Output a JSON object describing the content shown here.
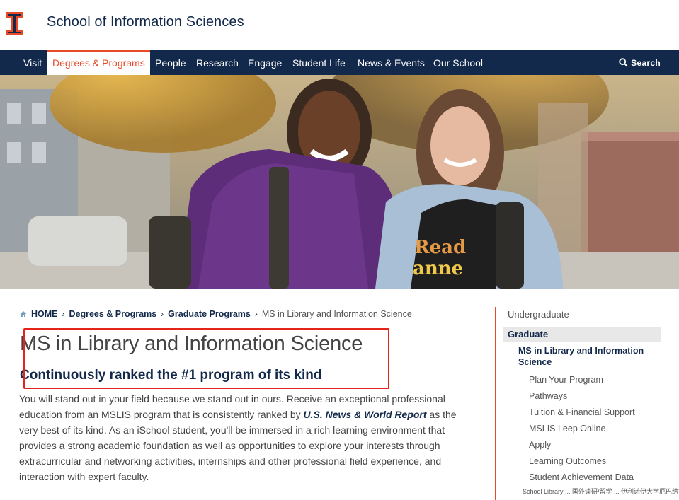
{
  "header": {
    "site_title": "School of Information Sciences",
    "brand_orange": "#e84a27",
    "brand_navy": "#13294b",
    "logo_icon": "block-i-logo"
  },
  "nav": {
    "items": [
      {
        "label": "Visit"
      },
      {
        "label": "Degrees & Programs",
        "active": true
      },
      {
        "label": "People"
      },
      {
        "label": "Research"
      },
      {
        "label": "Engage"
      },
      {
        "label": "Student Life"
      },
      {
        "label": "News & Events"
      },
      {
        "label": "Our School"
      }
    ],
    "search_label": "Search"
  },
  "breadcrumb": {
    "home": "HOME",
    "level1": "Degrees & Programs",
    "level2": "Graduate Programs",
    "current": "MS in Library and Information Science"
  },
  "main": {
    "title": "MS in Library and Information Science",
    "subheading": "Continuously ranked the #1 program of its kind",
    "body_part1": "You will stand out in your field because we stand out in ours. Receive an exceptional professional education from an MSLIS program that is consistently ranked by ",
    "body_link": "U.S. News & World Report",
    "body_part2": " as the very best of its kind. As an iSchool student, you'll be immersed in a rich learning environment that provides a strong academic foundation as well as opportunities to explore your interests through extracurricular and networking activities, internships and other professional field experience, and interaction with expert faculty."
  },
  "sidenav": {
    "undergraduate": "Undergraduate",
    "graduate": "Graduate",
    "current": "MS in Library and Information Science",
    "sub_items": [
      "Plan Your Program",
      "Pathways",
      "Tuition & Financial Support",
      "MSLIS Leep Online",
      "Apply",
      "Learning Outcomes",
      "Student Achievement Data"
    ]
  },
  "bottom_overlay": "School Library ... 国外读研/留学 ... 伊利诺伊大学厄巴纳香槟分校"
}
